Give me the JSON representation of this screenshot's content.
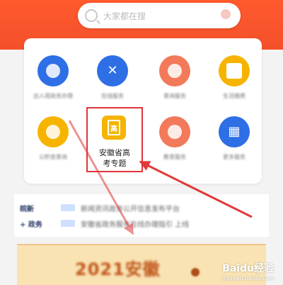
{
  "header": {
    "search_placeholder": "大家都在搜"
  },
  "grid": [
    {
      "label": "出入境政务办理",
      "color": "#2e6fe6",
      "icon": "phone-icon"
    },
    {
      "label": "在线服务",
      "color": "#2e6fe6",
      "icon": "cross-icon"
    },
    {
      "label": "查询服务",
      "color": "#f27a5a",
      "icon": "search-icon"
    },
    {
      "label": "生活缴费",
      "color": "#f6b400",
      "icon": "wallet-icon"
    },
    {
      "label": "公积金查询",
      "color": "#f6b400",
      "icon": "coin-icon"
    },
    {
      "label": "安徽省高考专题",
      "color": "#f6b400",
      "icon": "book-icon",
      "highlighted": true,
      "line1": "安徽省高",
      "line2": "考专题",
      "glyph": "高"
    },
    {
      "label": "教育服务",
      "color": "#f27a5a",
      "icon": "person-icon"
    },
    {
      "label": "更多服务",
      "color": "#2e6fe6",
      "icon": "grid-icon"
    }
  ],
  "news": [
    {
      "tag": "皖新",
      "text": "新闻资讯政务公开信息发布平台"
    },
    {
      "tag": "+ 政务",
      "text": "安徽省政务服务在线办理指引 上线"
    }
  ],
  "banner": {
    "text": "2021安徽"
  },
  "watermark": {
    "brand": "Baidu经验",
    "sub": "jingyan.baidu.com"
  },
  "colors": {
    "header": "#f4502a",
    "highlight": "#e0343a",
    "arrow": "#e03a3a"
  }
}
